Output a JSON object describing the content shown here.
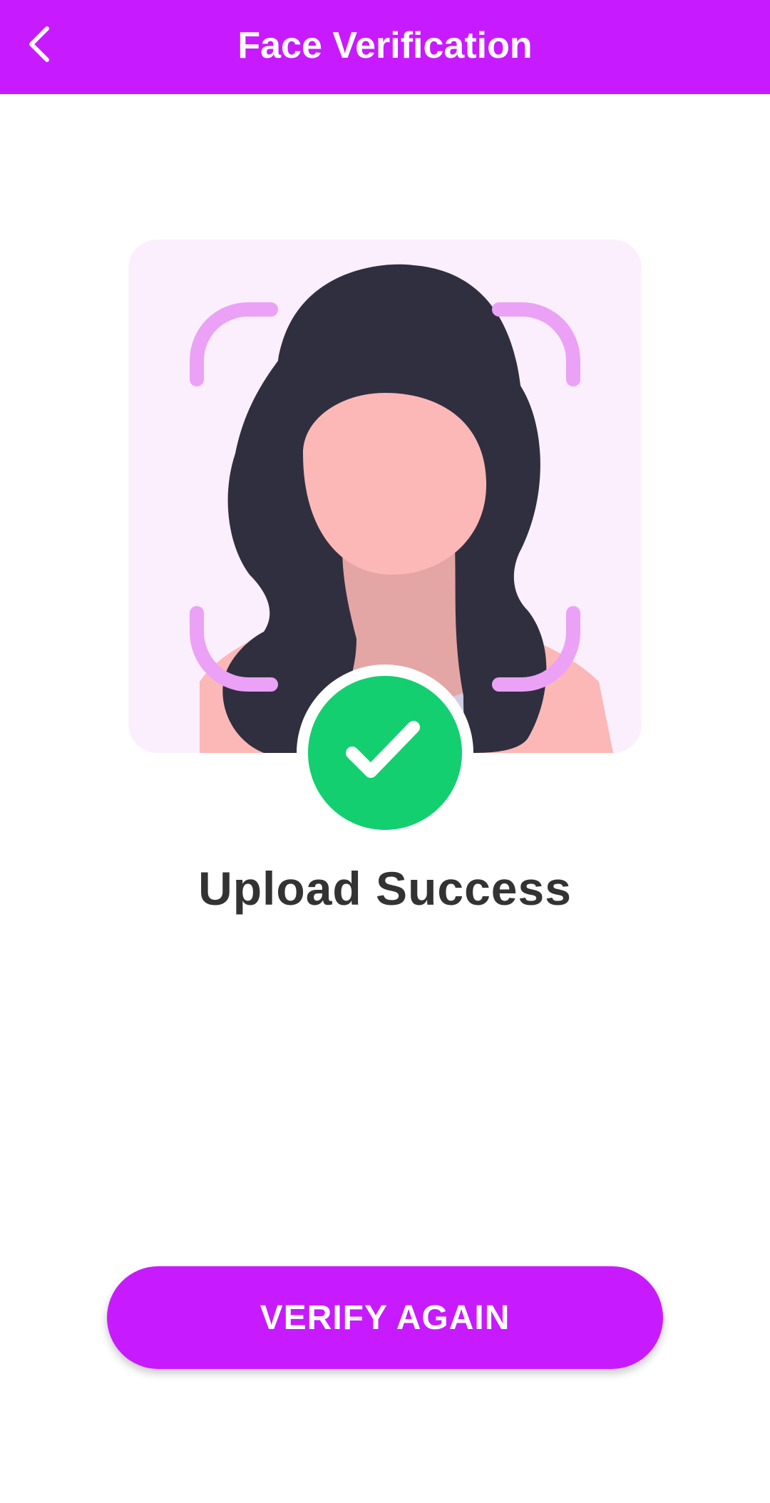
{
  "app_bar": {
    "title": "Face Verification",
    "back_icon": "chevron-left-icon",
    "background": "#c81aff"
  },
  "illustration": {
    "subject": "female-avatar",
    "frame_icon": "face-scan-corners-icon",
    "card_background": "#fbeffd"
  },
  "status": {
    "icon": "check-circle-icon",
    "icon_color": "#13cf6f",
    "text": "Upload Success"
  },
  "actions": {
    "verify_again_label": "VERIFY AGAIN",
    "button_color": "#c81aff"
  }
}
